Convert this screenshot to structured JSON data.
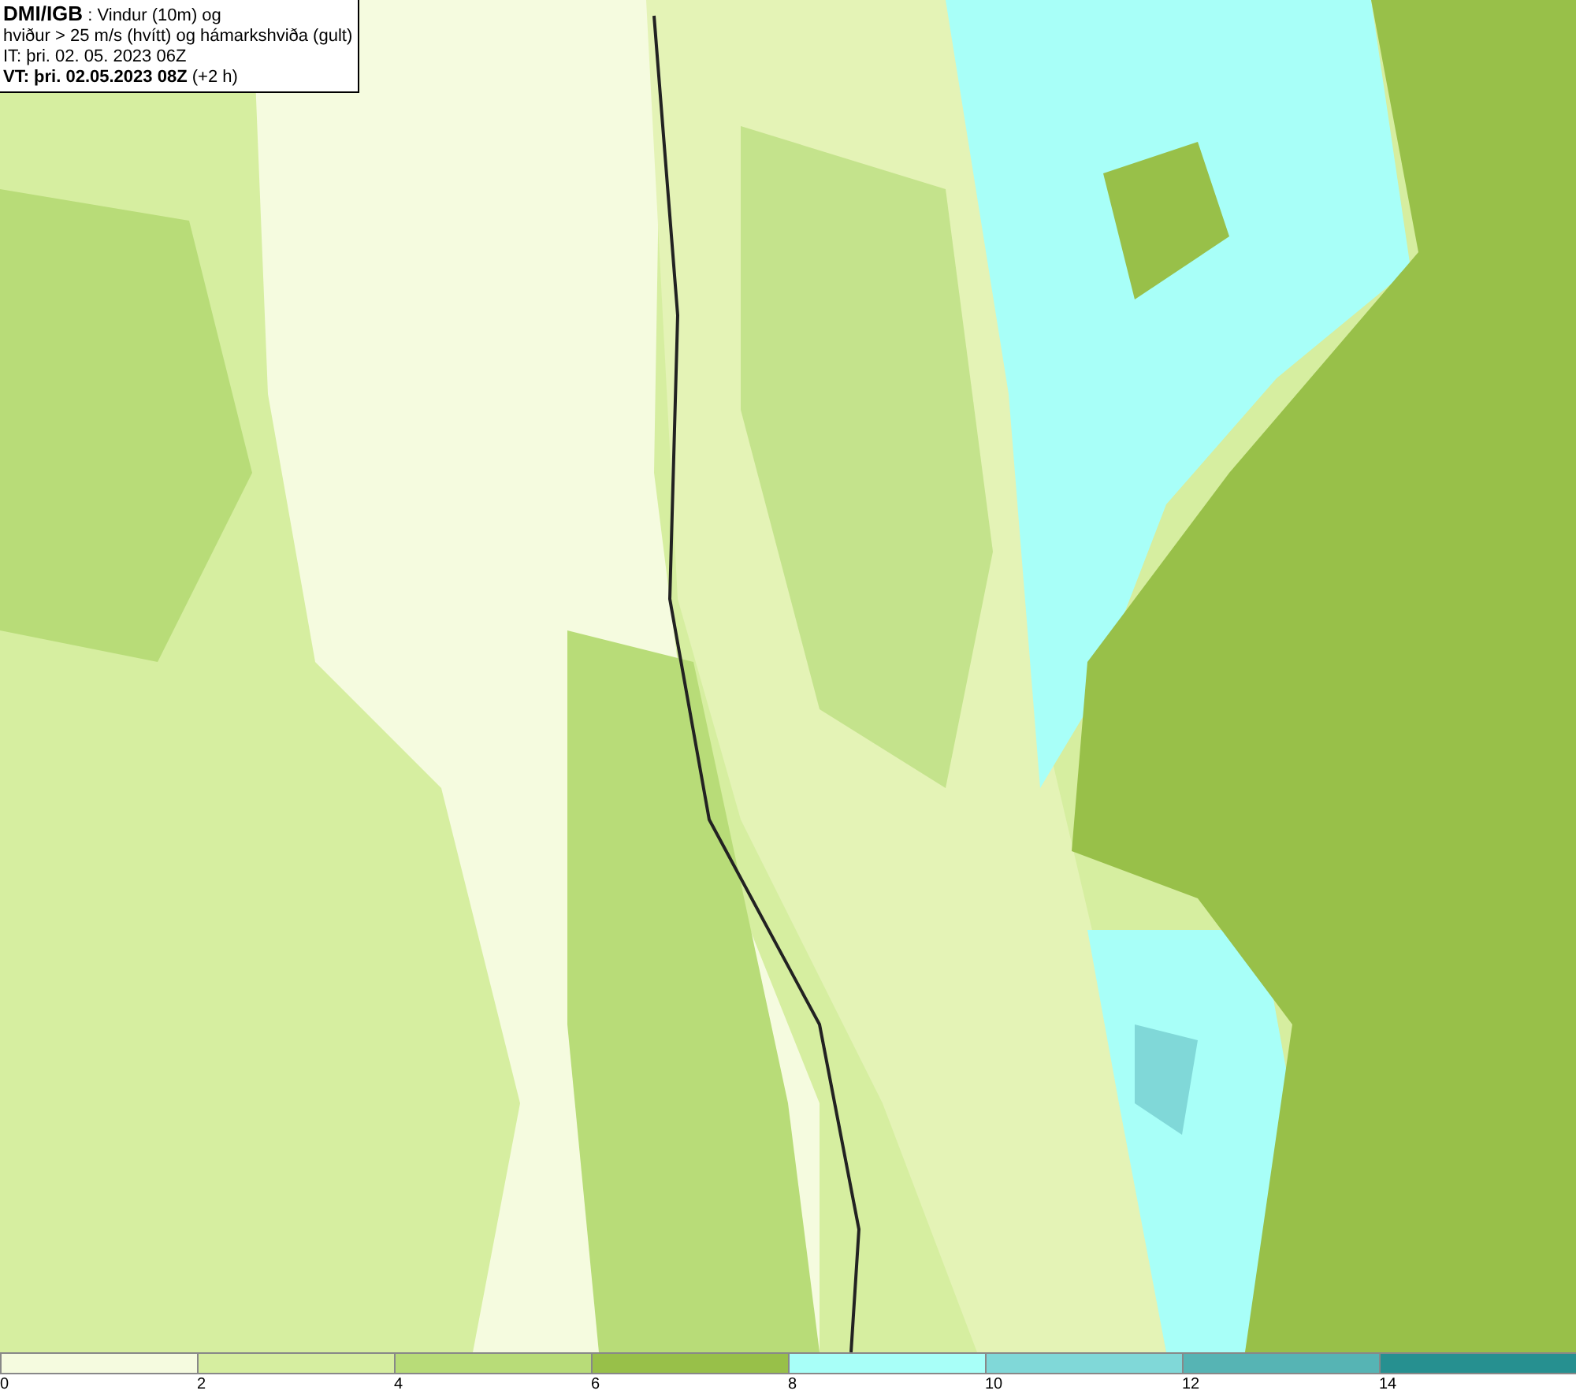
{
  "header": {
    "lines": [
      "**DMI/IGB** : Vindur (10m) og",
      "hviður > 25 m/s (hvítt) og hámarkshviða (gult)",
      "IT: þri. 02. 05. 2023 06Z",
      "**VT: þri. 02.05.2023 08Z** (+2 h)"
    ]
  },
  "legend": [
    {
      "label": "0",
      "color": "#f5fbdf"
    },
    {
      "label": "2",
      "color": "#d6eea0"
    },
    {
      "label": "4",
      "color": "#b8dc78"
    },
    {
      "label": "6",
      "color": "#98c049"
    },
    {
      "label": "8",
      "color": "#a8fff8"
    },
    {
      "label": "10",
      "color": "#80d8d8"
    },
    {
      "label": "12",
      "color": "#56b4b4"
    },
    {
      "label": "14",
      "color": "#269090"
    }
  ]
}
